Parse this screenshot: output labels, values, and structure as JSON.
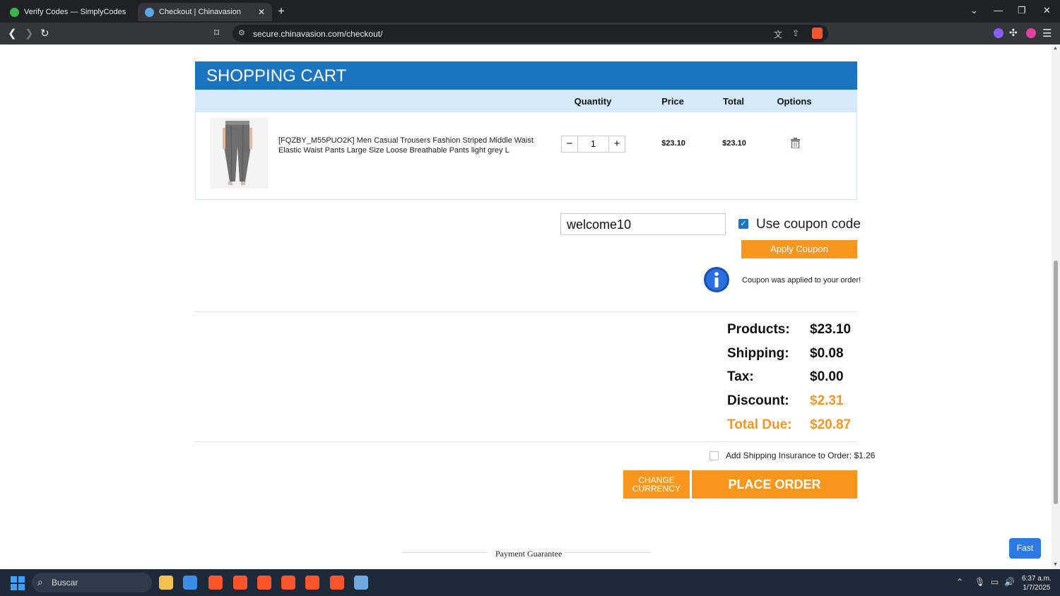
{
  "browser": {
    "tabs": [
      {
        "title": "Verify Codes — SimplyCodes",
        "active": false
      },
      {
        "title": "Checkout | Chinavasion",
        "active": true
      }
    ],
    "url": "secure.chinavasion.com/checkout/",
    "accent": "#1b74c0"
  },
  "cart": {
    "title": "SHOPPING CART",
    "columns": {
      "quantity": "Quantity",
      "price": "Price",
      "total": "Total",
      "options": "Options"
    },
    "item": {
      "name": "[FQZBY_M55PUO2K] Men Casual Trousers Fashion Striped Middle Waist Elastic Waist Pants Large Size Loose Breathable Pants light grey L",
      "quantity": "1",
      "price": "$23.10",
      "total": "$23.10"
    }
  },
  "coupon": {
    "code": "welcome10",
    "use_label": "Use coupon code",
    "apply_label": "Apply Coupon",
    "message": "Coupon was applied to your order!"
  },
  "totals": {
    "products_label": "Products:",
    "products": "$23.10",
    "shipping_label": "Shipping:",
    "shipping": "$0.08",
    "tax_label": "Tax:",
    "tax": "$0.00",
    "discount_label": "Discount:",
    "discount": "$2.31",
    "due_label": "Total Due:",
    "due": "$20.87"
  },
  "insurance_label": "Add Shipping Insurance to Order: $1.26",
  "buttons": {
    "change_currency_1": "CHANGE",
    "change_currency_2": "CURRENCY",
    "place_order": "PLACE ORDER",
    "fast": "Fast"
  },
  "payment_guarantee": "Payment Guarantee",
  "taskbar": {
    "search": "Buscar",
    "time": "6:37 a.m.",
    "date": "1/7/2025"
  },
  "colors": {
    "orange": "#f8961e",
    "blue": "#1b74c0"
  }
}
